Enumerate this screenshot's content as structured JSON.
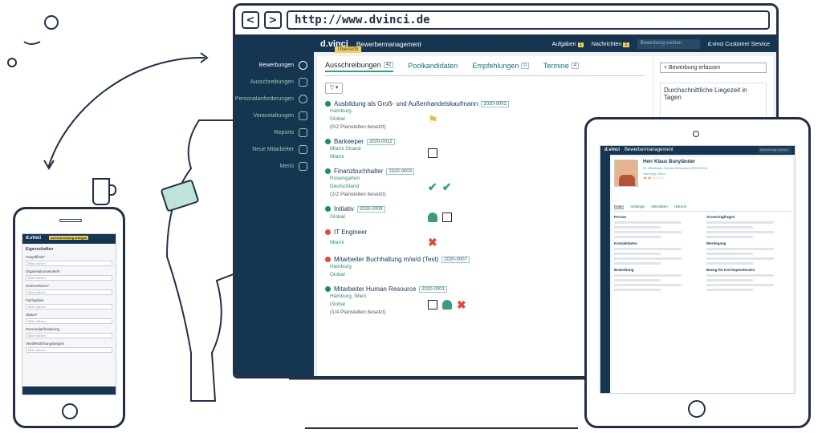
{
  "browser": {
    "back": "<",
    "forward": ">",
    "url": "http://www.dvinci.de"
  },
  "app": {
    "brand": "d.vinci",
    "product": "Bewerbermanagement",
    "tooltip": "Übersicht"
  },
  "topbar": {
    "tasks": "Aufgaben",
    "tasks_count": "1",
    "messages": "Nachrichten",
    "messages_count": "1",
    "search_placeholder": "Bewerbung suchen",
    "account": "d.vinci Customer Service"
  },
  "sidebar": {
    "items": [
      {
        "label": "Bewerbungen",
        "icon": "person-icon"
      },
      {
        "label": "Ausschreibungen",
        "icon": "folder-icon"
      },
      {
        "label": "Personalanforderungen",
        "icon": "spark-icon"
      },
      {
        "label": "Veranstaltungen",
        "icon": "calendar-icon"
      },
      {
        "label": "Reports",
        "icon": "chart-icon"
      },
      {
        "label": "Neue Mitarbeiter",
        "icon": "handshake-icon"
      },
      {
        "label": "Menü",
        "icon": "menu-icon"
      }
    ]
  },
  "tabs": [
    {
      "label": "Ausschreibungen",
      "count": "42"
    },
    {
      "label": "Poolkandidaten",
      "count": ""
    },
    {
      "label": "Empfehlungen",
      "count": "0"
    },
    {
      "label": "Termine",
      "count": "4"
    }
  ],
  "actions": {
    "new_posting": "+ Bewerbung erfassen",
    "filter": "▽ ▾"
  },
  "stats": {
    "title": "Durchschnittliche Liegezeit in Tagen"
  },
  "jobs": [
    {
      "title": "Ausbildung als Groß- und Außenhandelskaufmann",
      "id": "2020-0002",
      "status": "green",
      "lines": [
        "Hamburg",
        "Global",
        "(0/2 Planstellen besetzt)"
      ],
      "icons": [
        "flag"
      ]
    },
    {
      "title": "Barkeeper",
      "id": "2020-0012",
      "status": "green",
      "lines": [
        "Miami Strand",
        "Miami"
      ],
      "icons": [
        "copy"
      ]
    },
    {
      "title": "Finanzbuchhalter",
      "id": "2020-0003",
      "status": "green",
      "lines": [
        "Rosengarten",
        "Deutschland",
        "(2/2 Planstellen besetzt)"
      ],
      "icons": [
        "check",
        "check"
      ]
    },
    {
      "title": "Initiativ",
      "id": "2020-0008",
      "status": "green",
      "lines": [
        "Global"
      ],
      "icons": [
        "person",
        "calendar"
      ]
    },
    {
      "title": "IT Engineer",
      "id": "",
      "status": "red",
      "lines": [
        "Miami"
      ],
      "icons": [
        "x"
      ]
    },
    {
      "title": "Mitarbeiter Buchhaltung m/w/d (Test)",
      "id": "2020-0007",
      "status": "red",
      "lines": [
        "Hamburg",
        "Global"
      ],
      "icons": []
    },
    {
      "title": "Mitarbeiter Human Resource",
      "id": "2020-0001",
      "status": "green",
      "lines": [
        "Hamburg, Wien",
        "Global",
        "(1/4 Planstellen besetzt)"
      ],
      "icons": [
        "gear",
        "person",
        "x"
      ]
    }
  ],
  "phone": {
    "brand": "d.vinci",
    "tooltip": "Ausschreibung anlegen",
    "heading": "Eigenschaften",
    "fields": [
      "Hauptfiliale*",
      "Organisationseinheit*",
      "Unternehmen*",
      "Fachgebiet",
      "Status*",
      "Personalanforderung",
      "Veröffentlichungsbeginn"
    ],
    "placeholder": "Bitte wählen"
  },
  "tablet": {
    "brand": "d.vinci",
    "product": "Bewerbermanagement",
    "tooltip": "Bewerbung",
    "candidate": "Herr Klaus Bunyländer",
    "position": "ID: Mitarbeiter Human Resource (2020-0001)",
    "location": "Hamburg, Wien",
    "rating": "★★☆☆☆",
    "tabs": [
      "Daten",
      "Anhänge",
      "Aktivitäten",
      "Historie"
    ],
    "sections": [
      "Person",
      "Kontaktdaten",
      "Bewerbung",
      "Screeningfragen",
      "Werdegang",
      "Bezug für Korrespondenzen"
    ]
  }
}
